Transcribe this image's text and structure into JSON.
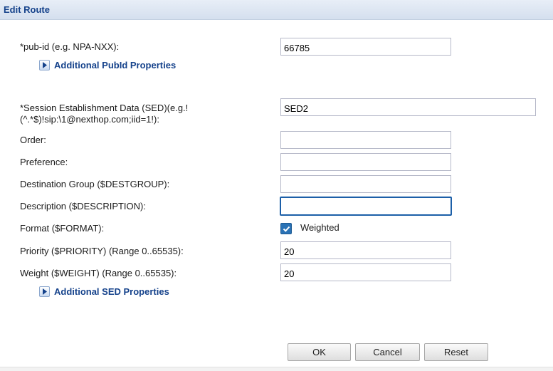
{
  "window": {
    "title": "Edit Route"
  },
  "form": {
    "pub_id": {
      "label": "*pub-id (e.g. NPA-NXX):",
      "value": "66785"
    },
    "additional_pubid": {
      "label": "Additional PubId Properties",
      "icon": "expand-arrow-icon"
    },
    "sed": {
      "label": "*Session Establishment Data (SED)(e.g.!(^.*$)!sip:\\1@nexthop.com;iid=1!):",
      "value": "SED2"
    },
    "order": {
      "label": "Order:",
      "value": ""
    },
    "preference": {
      "label": "Preference:",
      "value": ""
    },
    "destination_group": {
      "label": "Destination Group ($DESTGROUP):",
      "value": ""
    },
    "description": {
      "label": "Description ($DESCRIPTION):",
      "value": ""
    },
    "format": {
      "label": "Format ($FORMAT):",
      "checkbox_label": "Weighted",
      "checked": true
    },
    "priority": {
      "label": "Priority ($PRIORITY) (Range 0..65535):",
      "value": "20"
    },
    "weight": {
      "label": "Weight ($WEIGHT) (Range 0..65535):",
      "value": "20"
    },
    "additional_sed": {
      "label": "Additional SED Properties",
      "icon": "expand-arrow-icon"
    }
  },
  "buttons": {
    "ok": "OK",
    "cancel": "Cancel",
    "reset": "Reset"
  },
  "colors": {
    "title": "#15428b",
    "checkbox": "#2a72b5",
    "focus_border": "#1c5fa8"
  }
}
